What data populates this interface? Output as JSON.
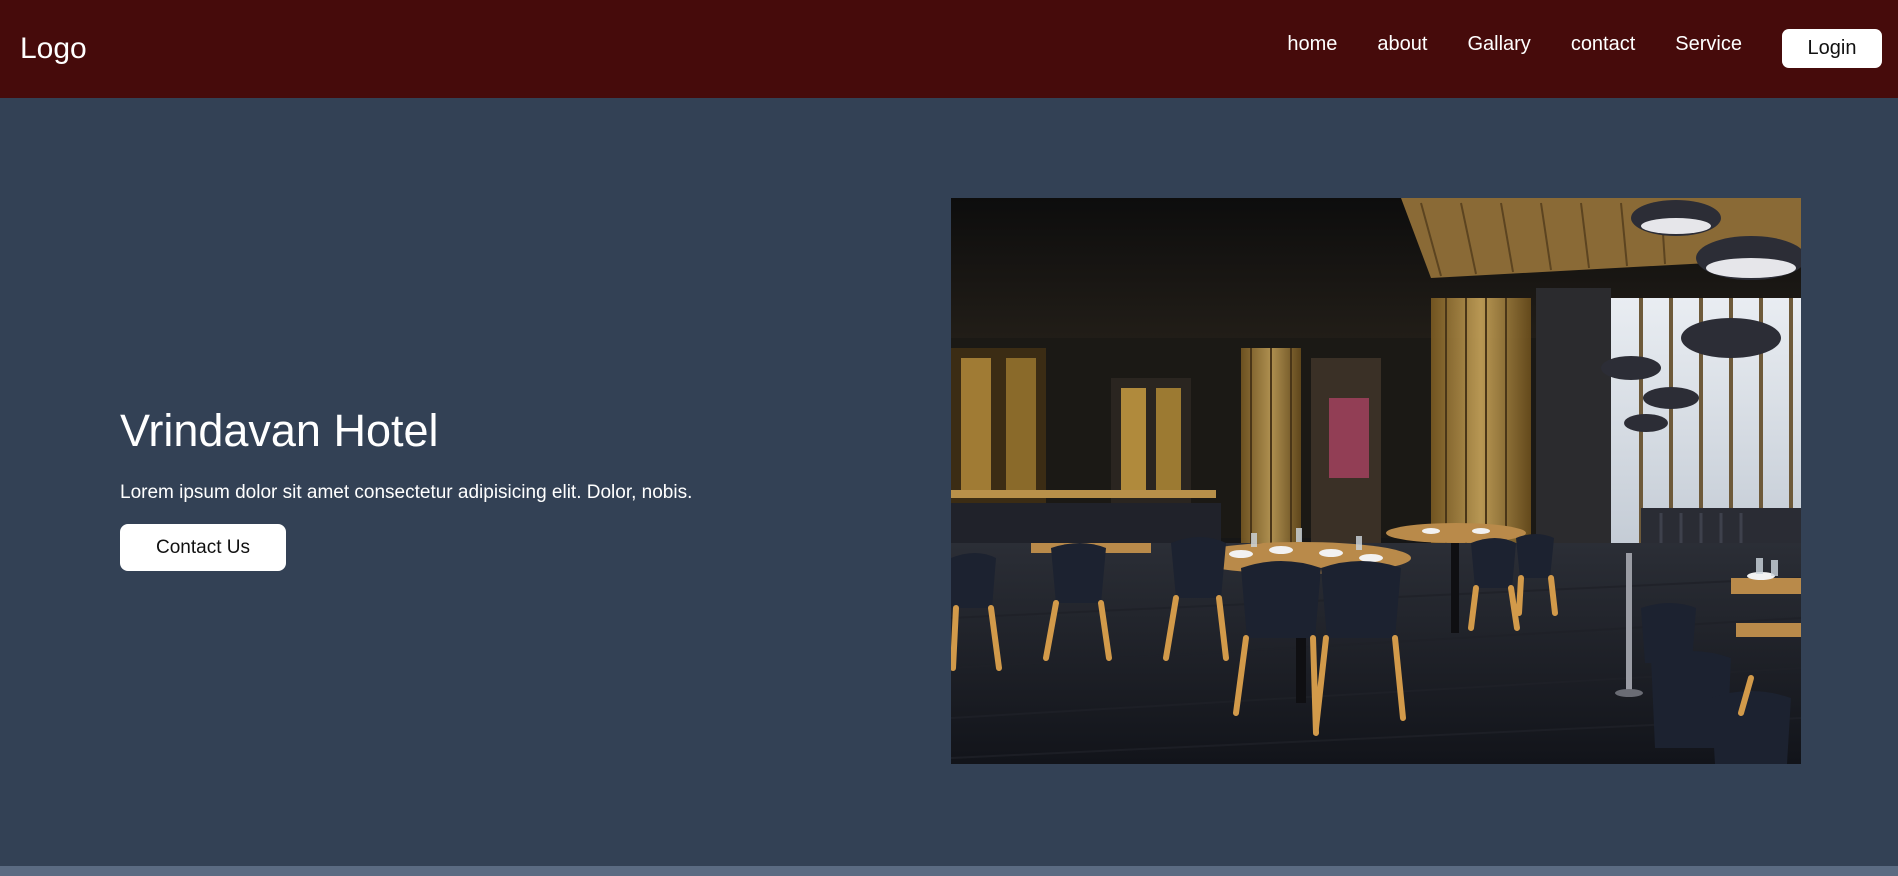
{
  "header": {
    "logo": "Logo",
    "nav": [
      "home",
      "about",
      "Gallary",
      "contact",
      "Service"
    ],
    "login_label": "Login"
  },
  "hero": {
    "title": "Vrindavan Hotel",
    "text": "Lorem ipsum dolor sit amet consectetur adipisicing elit. Dolor, nobis.",
    "button_label": "Contact Us",
    "image": "restaurant-interior-photo"
  },
  "colors": {
    "navbar": "#460b0b",
    "background": "#334155",
    "button": "#ffffff"
  }
}
